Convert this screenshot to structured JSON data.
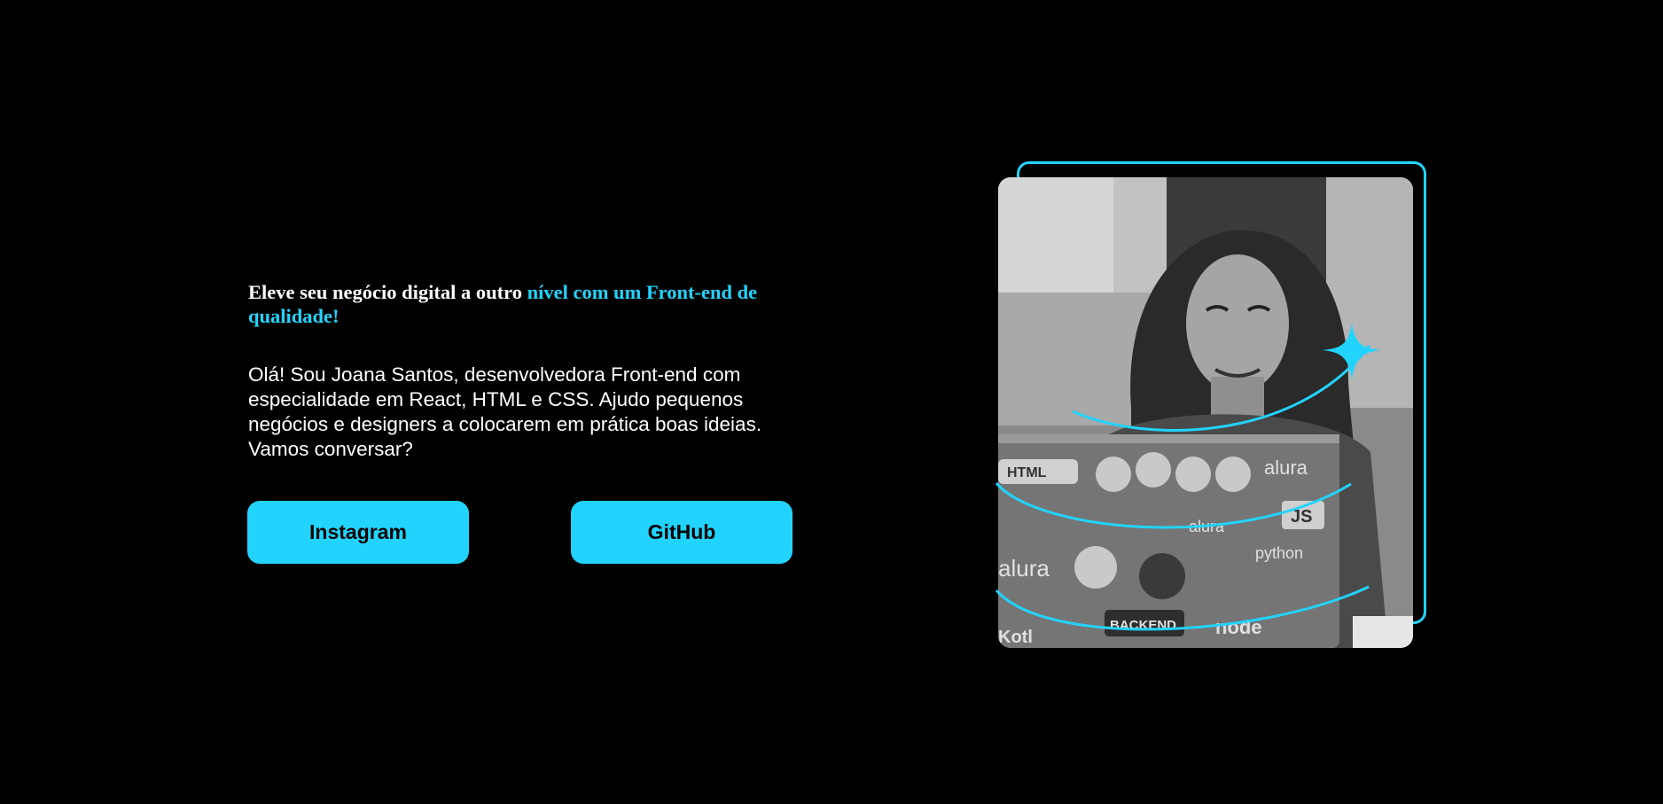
{
  "hero": {
    "headline_white": "Eleve seu negócio digital a outro ",
    "headline_accent": "nível com um Front-end de qualidade!",
    "intro": "Olá! Sou Joana Santos, desenvolvedora Front-end com especialidade em React, HTML e CSS. Ajudo pequenos negócios e designers a colocarem em prática boas ideias. Vamos conversar?"
  },
  "buttons": {
    "instagram_label": "Instagram",
    "github_label": "GitHub"
  },
  "photo": {
    "sticker_html": "HTML",
    "sticker_alura": "alura",
    "sticker_js": "JS",
    "sticker_python": "python",
    "sticker_backend": "BACKEND",
    "sticker_node": "node",
    "sticker_kotlin": "Kotl",
    "sticker_alura_2": "alura",
    "sticker_alura_3": "alura"
  },
  "colors": {
    "background": "#000000",
    "accent": "#22d4fd",
    "text": "#ffffff",
    "button_text": "#000000"
  },
  "icons": {
    "sparkle": "sparkle-icon"
  }
}
